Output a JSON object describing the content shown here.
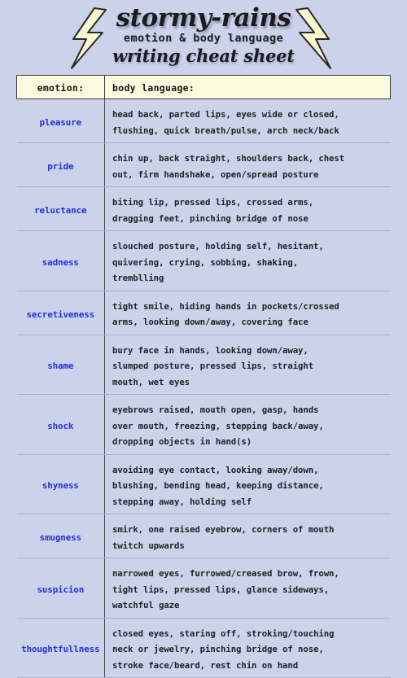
{
  "header": {
    "title": "stormy-rains",
    "subtitle": "emotion & body language",
    "tagline": "writing cheat sheet",
    "bolt_left": "lightning-bolt",
    "bolt_right": "lightning-bolt",
    "bolt_fill": "#fbf8d0",
    "bolt_stroke": "#2a2a2a"
  },
  "colors": {
    "background": "#ccd2ea",
    "header_cell": "#fbfbdf",
    "emotion_text": "#2233dd",
    "body_text": "#222226",
    "rule": "#a9afc8",
    "divider": "#4a4a55"
  },
  "table": {
    "columns": [
      "emotion:",
      "body language:"
    ],
    "rows": [
      {
        "emotion": "pleasure",
        "body_language": "head back, parted lips, eyes wide or closed,\nflushing, quick breath/pulse, arch neck/back"
      },
      {
        "emotion": "pride",
        "body_language": "chin up, back straight, shoulders back, chest\nout, firm handshake, open/spread posture"
      },
      {
        "emotion": "reluctance",
        "body_language": "biting lip, pressed lips, crossed arms,\ndragging feet, pinching bridge of nose"
      },
      {
        "emotion": "sadness",
        "body_language": "slouched posture, holding self, hesitant,\nquivering, crying, sobbing, shaking,\ntremblling"
      },
      {
        "emotion": "secretiveness",
        "body_language": "tight smile, hiding hands in pockets/crossed\narms, looking down/away, covering face"
      },
      {
        "emotion": "shame",
        "body_language": "bury face in hands, looking down/away,\nslumped posture, pressed lips, straight\nmouth, wet eyes"
      },
      {
        "emotion": "shock",
        "body_language": "eyebrows raised, mouth open, gasp, hands\nover mouth, freezing, stepping back/away,\ndropping objects in hand(s)"
      },
      {
        "emotion": "shyness",
        "body_language": "avoiding eye contact, looking away/down,\nblushing, bending head, keeping distance,\nstepping away, holding self"
      },
      {
        "emotion": "smugness",
        "body_language": "smirk, one raised eyebrow, corners of mouth\ntwitch upwards"
      },
      {
        "emotion": "suspicion",
        "body_language": "narrowed eyes, furrowed/creased brow, frown,\ntight lips, pressed lips, glance sideways,\nwatchful gaze"
      },
      {
        "emotion": "thoughtfullness",
        "body_language": "closed eyes, staring off, stroking/touching\nneck or jewelry, pinching bridge of nose,\nstroke face/beard, rest chin on hand"
      }
    ]
  }
}
